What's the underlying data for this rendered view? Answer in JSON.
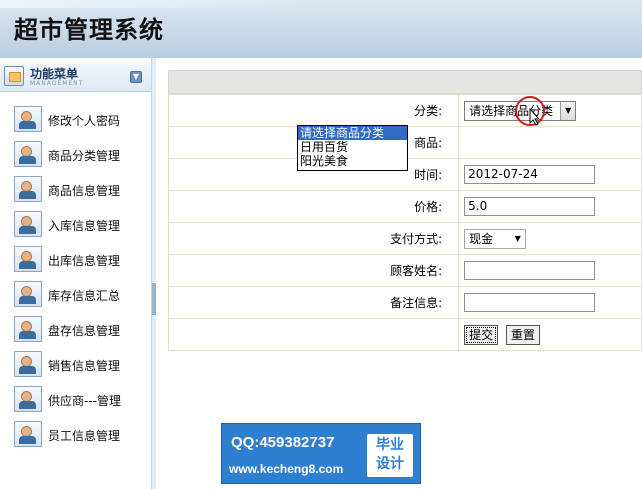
{
  "app": {
    "title": "超市管理系统"
  },
  "sidebar": {
    "header_title": "功能菜单",
    "header_subtitle": "MANAGEMENT",
    "items": [
      {
        "label": "修改个人密码"
      },
      {
        "label": "商品分类管理"
      },
      {
        "label": "商品信息管理"
      },
      {
        "label": "入库信息管理"
      },
      {
        "label": "出库信息管理"
      },
      {
        "label": "库存信息汇总"
      },
      {
        "label": "盘存信息管理"
      },
      {
        "label": "销售信息管理"
      },
      {
        "label": "供应商---管理"
      },
      {
        "label": "员工信息管理"
      }
    ]
  },
  "form": {
    "category_label": "分类:",
    "category_value": "请选择商品分类",
    "category_options": [
      "请选择商品分类",
      "日用百货",
      "阳光美食"
    ],
    "product_label": "商品:",
    "time_label": "时间:",
    "time_value": "2012-07-24",
    "price_label": "价格:",
    "price_value": "5.0",
    "payment_label": "支付方式:",
    "payment_value": "现金",
    "customer_label": "顾客姓名:",
    "customer_value": "",
    "remark_label": "备注信息:",
    "remark_value": "",
    "submit_label": "提交",
    "reset_label": "重置"
  },
  "watermark": {
    "qq": "QQ:459382737",
    "site": "www.kecheng8.com",
    "badge_line1": "毕业",
    "badge_line2": "设计"
  },
  "colors": {
    "header_bg": "#c8d8e8",
    "selection": "#316ac5",
    "watermark_bg": "#2f7fd0"
  },
  "icons": {
    "menu_item": "user-icon",
    "menu_header": "folder-icon",
    "toggle": "chevron-down-icon"
  }
}
